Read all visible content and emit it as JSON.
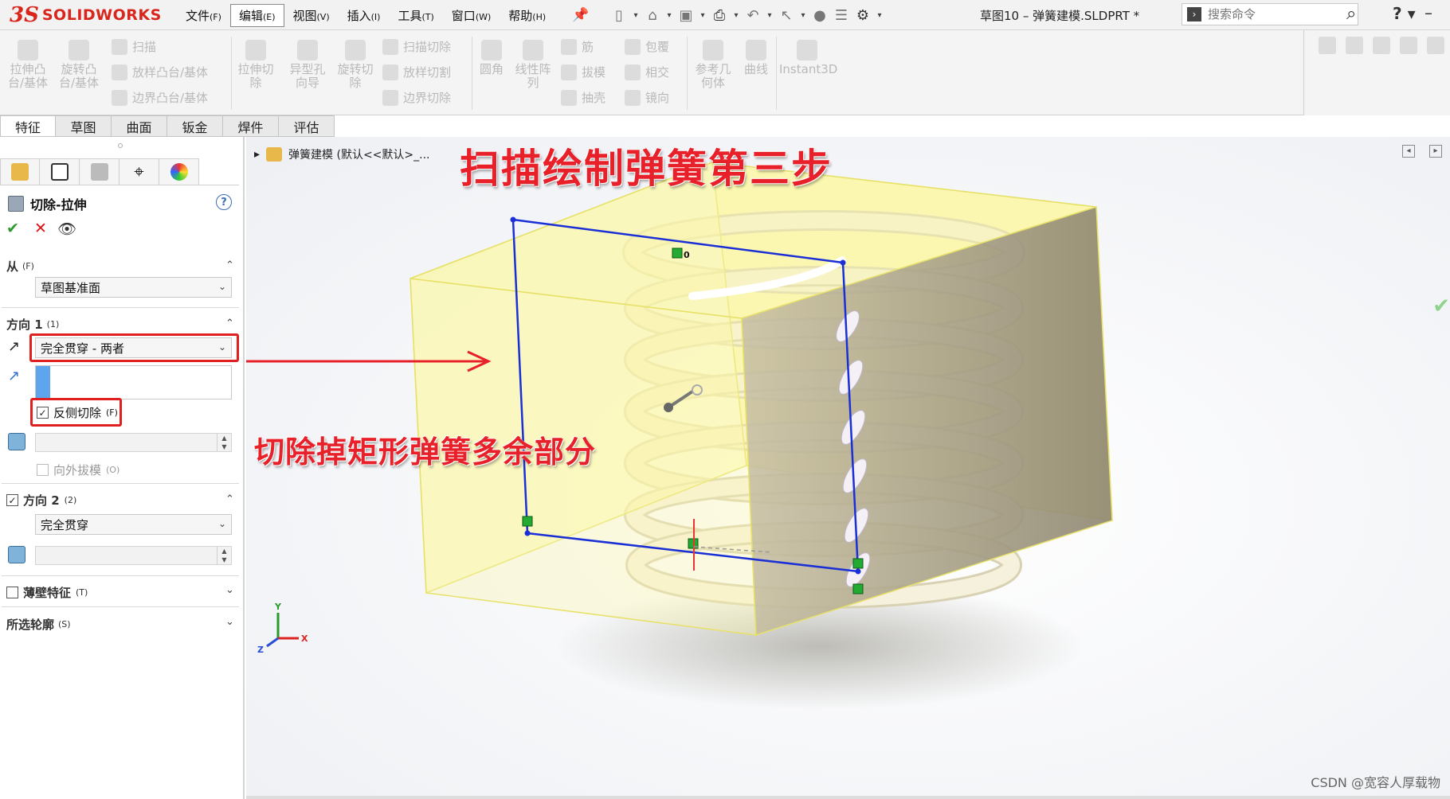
{
  "app": {
    "logo_prefix": "3S",
    "logo_text": "SOLIDWORKS",
    "document_title": "草图10 – 弹簧建模.SLDPRT *"
  },
  "menu": [
    {
      "label": "文件",
      "accel": "(F)"
    },
    {
      "label": "编辑",
      "accel": "(E)"
    },
    {
      "label": "视图",
      "accel": "(V)"
    },
    {
      "label": "插入",
      "accel": "(I)"
    },
    {
      "label": "工具",
      "accel": "(T)"
    },
    {
      "label": "窗口",
      "accel": "(W)"
    },
    {
      "label": "帮助",
      "accel": "(H)"
    }
  ],
  "search": {
    "placeholder": "搜索命令"
  },
  "ribbon": {
    "extrude_boss": "拉伸凸\n台/基体",
    "revolve_boss": "旋转凸\n台/基体",
    "sweep": "扫描",
    "loft_boss": "放样凸台/基体",
    "boundary_boss": "边界凸台/基体",
    "extrude_cut": "拉伸切\n除",
    "hole_wizard": "异型孔\n向导",
    "revolve_cut": "旋转切\n除",
    "sweep_cut": "扫描切除",
    "loft_cut": "放样切割",
    "boundary_cut": "边界切除",
    "fillet": "圆角",
    "linear_pattern": "线性阵\n列",
    "rib": "筋",
    "draft": "拔模",
    "shell": "抽壳",
    "wrap": "包覆",
    "intersect": "相交",
    "mirror": "镜向",
    "ref_geometry": "参考几\n何体",
    "curves": "曲线",
    "instant3d": "Instant3D"
  },
  "command_tabs": [
    "特征",
    "草图",
    "曲面",
    "钣金",
    "焊件",
    "评估"
  ],
  "property_manager": {
    "title": "切除-拉伸",
    "help": "?",
    "from": {
      "label": "从",
      "accel": "(F)",
      "value": "草图基准面"
    },
    "direction1": {
      "label": "方向 1",
      "accel": "(1)",
      "end_condition": "完全贯穿 - 两者",
      "flip_side_cut": {
        "label": "反侧切除",
        "accel": "(F)",
        "checked": true
      },
      "draft_outward": {
        "label": "向外拔模",
        "accel": "(O)",
        "checked": false
      }
    },
    "direction2": {
      "label": "方向 2",
      "accel": "(2)",
      "checked": true,
      "end_condition": "完全贯穿"
    },
    "thin_feature": {
      "label": "薄壁特征",
      "accel": "(T)",
      "checked": false
    },
    "selected_contours": {
      "label": "所选轮廓",
      "accel": "(S)"
    }
  },
  "viewport": {
    "tree_path": "弹簧建模  (默认<<默认>_...",
    "headline": "扫描绘制弹簧第三步",
    "annotation": "切除掉矩形弹簧多余部分",
    "watermark": "CSDN @宽容人厚载物",
    "sketch_relation_label": "0",
    "triad_labels": {
      "x": "X",
      "y": "Y",
      "z": "Z"
    }
  },
  "colors": {
    "logo_red": "#d9261c",
    "annotation_red": "#e8202a",
    "sketch_blue": "#1a2fd6",
    "box_yellow": "#fbf7a8",
    "spring_cream": "#f6f1dc"
  }
}
